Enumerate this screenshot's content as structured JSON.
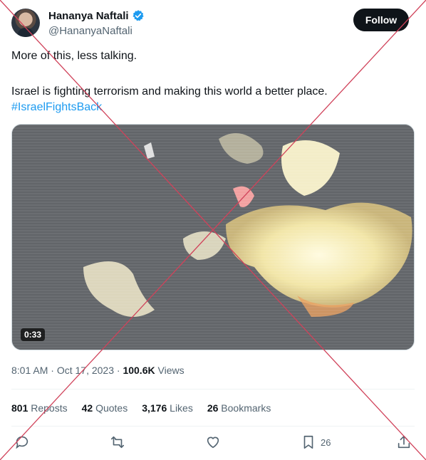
{
  "author": {
    "name": "Hananya Naftali",
    "handle": "@HananyaNaftali",
    "verified": true
  },
  "follow_label": "Follow",
  "tweet": {
    "line1": "More of this, less talking.",
    "line2": "Israel is fighting terrorism and making this world a better place.",
    "hashtag": "#IsraelFightsBack"
  },
  "media": {
    "duration": "0:33"
  },
  "meta": {
    "time": "8:01 AM",
    "separator1": " · ",
    "date": "Oct 17, 2023",
    "separator2": " · ",
    "views_count": "100.6K",
    "views_label": " Views"
  },
  "stats": {
    "reposts_count": "801",
    "reposts_label": " Reposts",
    "quotes_count": "42",
    "quotes_label": " Quotes",
    "likes_count": "3,176",
    "likes_label": " Likes",
    "bookmarks_count": "26",
    "bookmarks_label": " Bookmarks"
  },
  "actions": {
    "bookmark_count": "26"
  },
  "colors": {
    "accent": "#1d9bf0",
    "follow_bg": "#0f1419",
    "cross_mark": "#d0425a"
  },
  "icons": [
    "verified-badge-icon",
    "reply-icon",
    "repost-icon",
    "like-icon",
    "bookmark-icon",
    "share-icon"
  ]
}
